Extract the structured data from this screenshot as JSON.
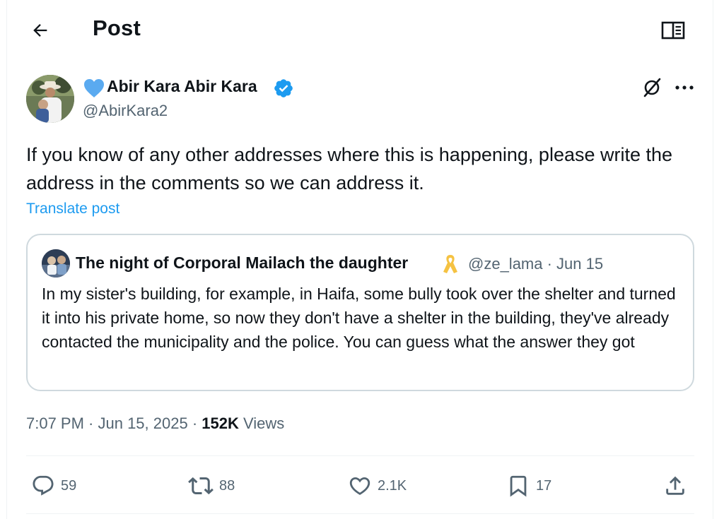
{
  "header": {
    "title": "Post",
    "back_icon": "arrow-left-icon",
    "reader_icon": "open-book-icon"
  },
  "author": {
    "display_name": "Abir Kara Abir Kara",
    "handle": "@AbirKara2",
    "name_prefix_icon": "blue-heart-icon",
    "verified_icon": "verified-badge-icon"
  },
  "post": {
    "text": "If you know of any other addresses where this is happening, please write the address in the comments so we can address it.",
    "translate_label": "Translate post"
  },
  "quote": {
    "author_name": "The night of Corporal Mailach the daughter",
    "name_suffix_icon": "yellow-ribbon-icon",
    "meta": "@ze_lama · Jun 15",
    "text": "In my sister's building, for example, in Haifa, some bully took over the shelter and turned it into his private home, so now they don't have a shelter in the building, they've already contacted the municipality and the police. You can guess what the answer they got"
  },
  "stats": {
    "time_date": "7:07 PM · Jun 15, 2025 · ",
    "views_count": "152K",
    "views_label": " Views"
  },
  "actions": {
    "replies": "59",
    "reposts": "88",
    "likes": "2.1K",
    "bookmarks": "17"
  },
  "colors": {
    "text": "#0f1419",
    "secondary": "#536471",
    "link": "#1d9bf0",
    "verified": "#1d9bf0",
    "border": "#cfd9de",
    "ribbon": "#f5c242"
  }
}
